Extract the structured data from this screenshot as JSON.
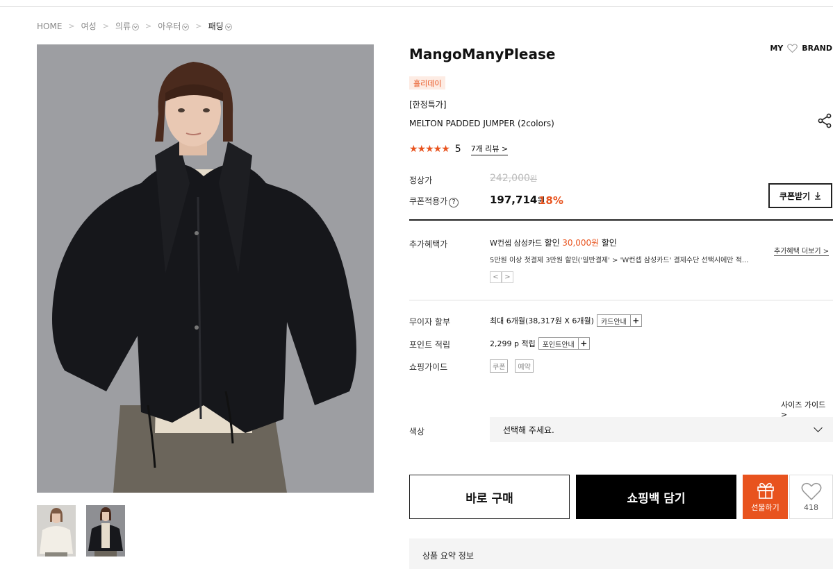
{
  "breadcrumb": {
    "home": "HOME",
    "women": "여성",
    "clothing": "의류",
    "outer": "아우터",
    "padding": "패딩"
  },
  "product": {
    "brand": "MangoManyPlease",
    "tag": "홀리데이",
    "subtitle": "[한정특가]",
    "name": "MELTON PADDED JUMPER (2colors)",
    "stars": "★★★★★",
    "rating": "5",
    "reviews_label": "7개 리뷰"
  },
  "header_links": {
    "my": "MY",
    "brand": "BRAND"
  },
  "price": {
    "regular_label": "정상가",
    "regular_value": "242,000",
    "regular_unit": "원",
    "coupon_label": "쿠폰적용가",
    "sale_value": "197,714",
    "sale_unit": "원",
    "discount": "18%",
    "coupon_button": "쿠폰받기"
  },
  "benefit": {
    "label": "추가혜택가",
    "card": "W컨셉 삼성카드",
    "discount_word": "할인",
    "amount": "30,000원",
    "discount_word2": "할인",
    "detail": "5만원 이상 첫결제 3만원 할인('일반결제' > 'W컨셉 삼성카드' 결제수단 선택시에만 적...",
    "more": "추가혜택 더보기",
    "prev": "<",
    "next": ">"
  },
  "installment": {
    "label": "무이자 할부",
    "value": "최대 6개월(38,317원 X 6개월)",
    "button": "카드안내"
  },
  "points": {
    "label": "포인트 적립",
    "value": "2,299 p 적립",
    "button": "포인트안내"
  },
  "guide": {
    "label": "쇼핑가이드",
    "chip1": "쿠폰",
    "chip2": "예약"
  },
  "size_guide": "사이즈 가이드",
  "color": {
    "label": "색상",
    "placeholder": "선택해 주세요."
  },
  "actions": {
    "buy": "바로 구매",
    "cart": "쇼핑백 담기",
    "gift": "선물하기",
    "likes": "418"
  },
  "summary": "상품 요약 정보",
  "colors": {
    "accent": "#e8531e",
    "black": "#000000"
  }
}
